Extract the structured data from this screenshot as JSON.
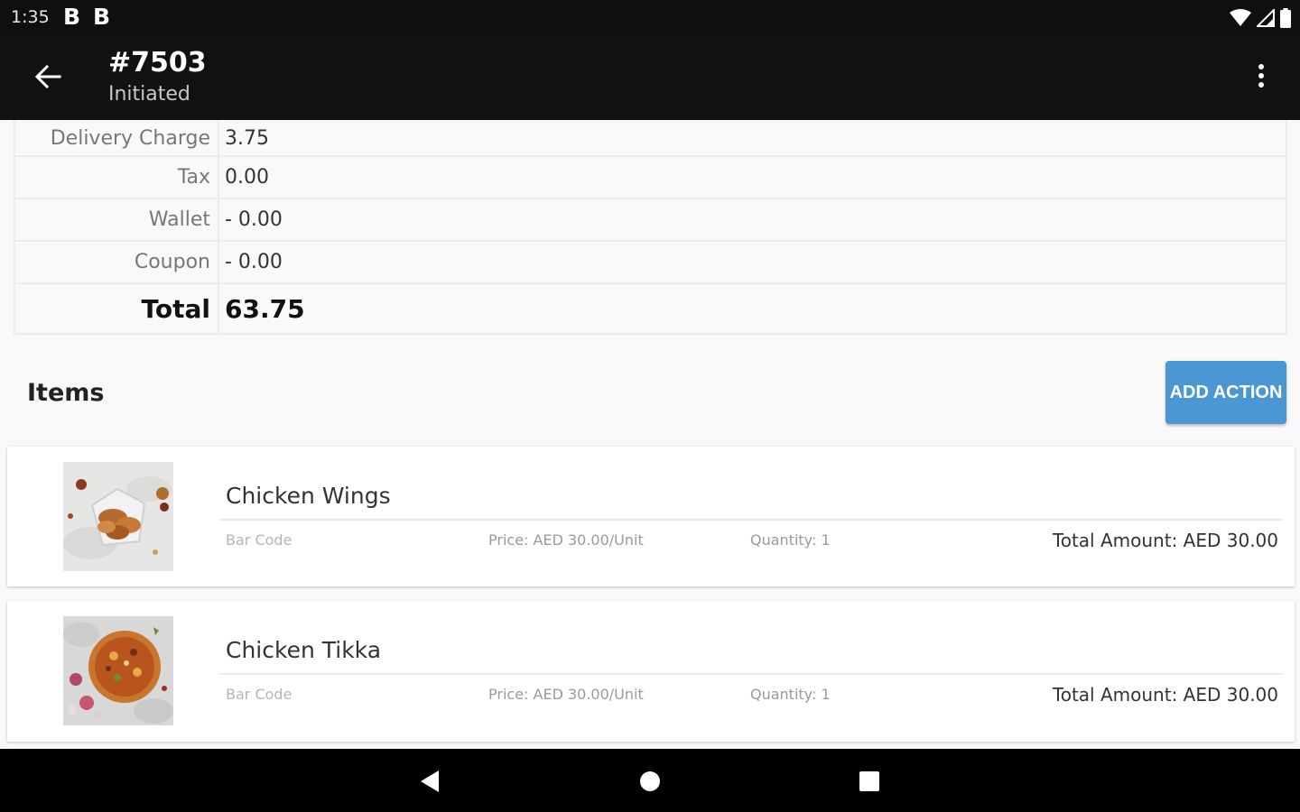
{
  "status_bar": {
    "time": "1:35",
    "notif_1": "B",
    "notif_2": "B"
  },
  "app_bar": {
    "order_number": "#7503",
    "order_status": "Initiated"
  },
  "summary": {
    "rows": [
      {
        "label": "Delivery Charge",
        "value": "3.75"
      },
      {
        "label": "Tax",
        "value": "0.00"
      },
      {
        "label": "Wallet",
        "value": "- 0.00"
      },
      {
        "label": "Coupon",
        "value": "- 0.00"
      }
    ],
    "total_label": "Total",
    "total_value": "63.75"
  },
  "items_section": {
    "title": "Items",
    "add_action_label": "ADD ACTION"
  },
  "items": [
    {
      "name": "Chicken Wings",
      "barcode": "Bar Code",
      "price": "Price: AED 30.00/Unit",
      "quantity": "Quantity: 1",
      "total": "Total Amount: AED 30.00"
    },
    {
      "name": "Chicken Tikka",
      "barcode": "Bar Code",
      "price": "Price: AED 30.00/Unit",
      "quantity": "Quantity: 1",
      "total": "Total Amount: AED 30.00"
    }
  ],
  "colors": {
    "app_bar": "#111111",
    "accent_button": "#4a97d4",
    "background": "#f9f9f9"
  },
  "icons": {
    "back": "arrow-left-icon",
    "menu": "more-vert-icon",
    "wifi": "wifi-icon",
    "signal": "signal-icon",
    "battery": "battery-icon",
    "nav_back": "triangle-back-icon",
    "nav_home": "circle-home-icon",
    "nav_recent": "square-recents-icon"
  }
}
